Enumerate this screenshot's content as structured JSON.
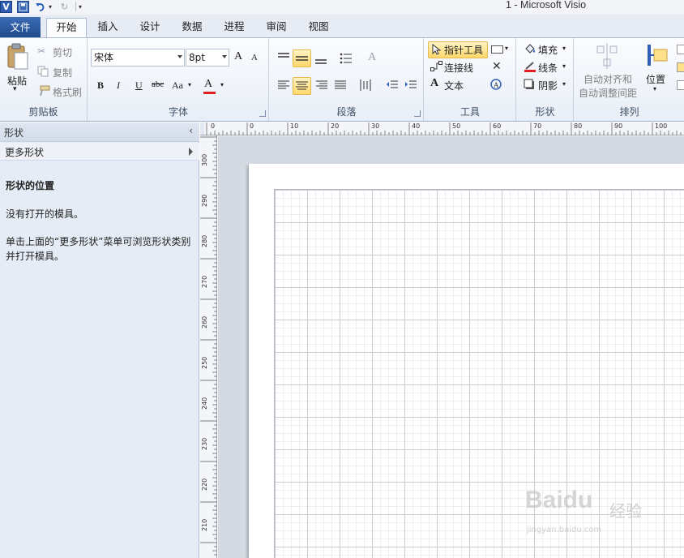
{
  "window": {
    "title": "1  -  Microsoft Visio"
  },
  "quick_access": {
    "app_icon_label": "V"
  },
  "tabs": [
    {
      "label": "文件"
    },
    {
      "label": "开始"
    },
    {
      "label": "插入"
    },
    {
      "label": "设计"
    },
    {
      "label": "数据"
    },
    {
      "label": "进程"
    },
    {
      "label": "审阅"
    },
    {
      "label": "视图"
    }
  ],
  "ribbon": {
    "clipboard": {
      "label": "剪贴板",
      "paste": "粘贴",
      "cut": "剪切",
      "copy": "复制",
      "format_painter": "格式刷"
    },
    "font": {
      "label": "字体",
      "font_name": "宋体",
      "font_size": "8pt",
      "grow": "A",
      "shrink": "A",
      "bold": "B",
      "italic": "I",
      "underline": "U",
      "strike": "abc",
      "case": "Aa",
      "color": "A"
    },
    "paragraph": {
      "label": "段落"
    },
    "tools": {
      "label": "工具",
      "pointer": "指针工具",
      "connector": "连接线",
      "text": "文本"
    },
    "shape": {
      "label": "形状",
      "fill": "填充",
      "line": "线条",
      "shadow": "阴影"
    },
    "arrange": {
      "label": "排列",
      "auto_align": "自动对齐和",
      "auto_space": "自动调整间距",
      "position": "位置"
    }
  },
  "shapes_pane": {
    "title": "形状",
    "more_shapes": "更多形状",
    "heading": "形状的位置",
    "no_stencil": "没有打开的模具。",
    "hint": "单击上面的“更多形状”菜单可浏览形状类别并打开模具。"
  },
  "ruler": {
    "top_labels": [
      "0",
      "0",
      "10",
      "20",
      "30",
      "40",
      "50",
      "60",
      "70",
      "80",
      "90",
      "100"
    ],
    "left_labels": [
      "300",
      "290",
      "280",
      "270",
      "260",
      "250",
      "240",
      "230",
      "220",
      "210"
    ]
  },
  "watermark": {
    "text": "Baidu",
    "cn": "经验",
    "sub": "jingyan.baidu.com"
  }
}
